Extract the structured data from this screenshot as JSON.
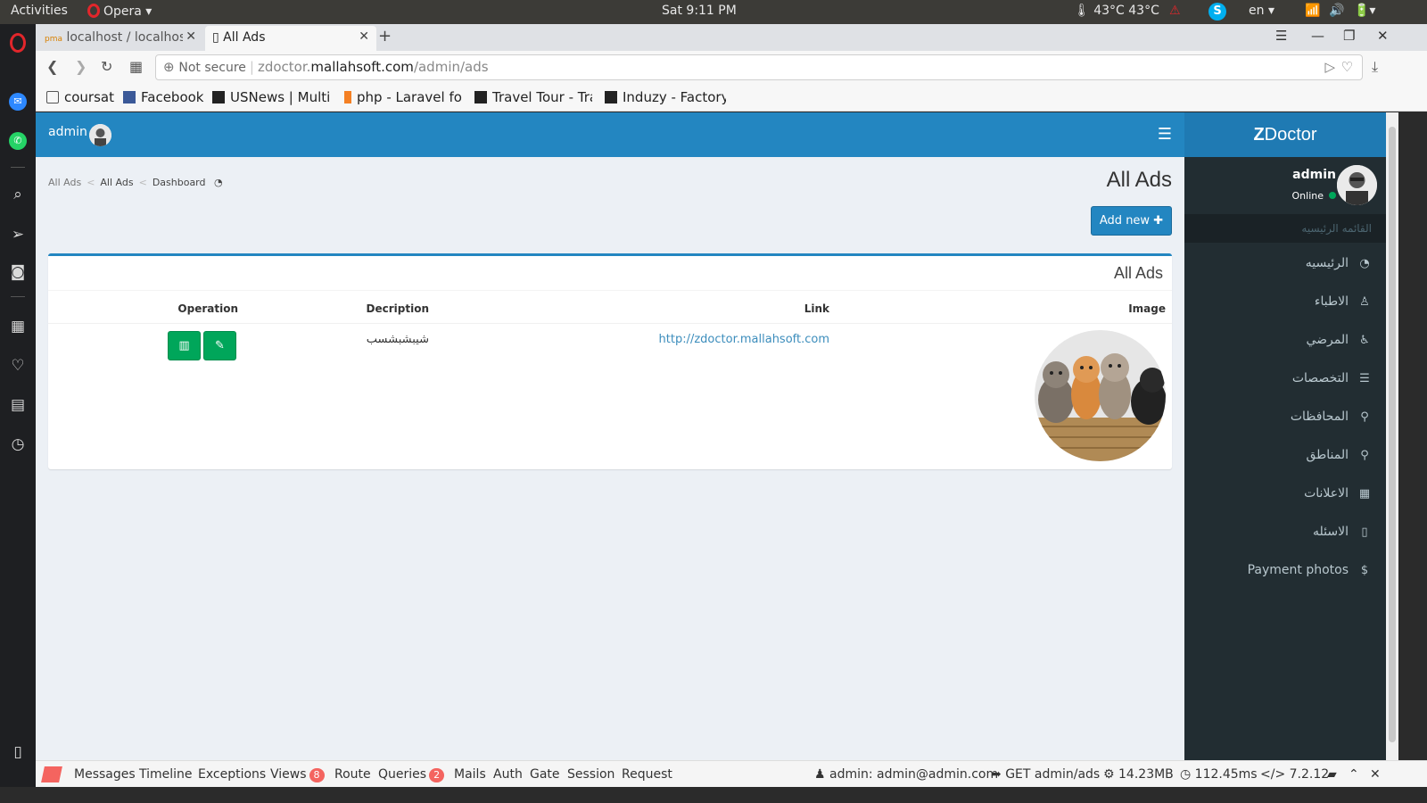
{
  "os": {
    "activities": "Activities",
    "app_name": "Opera",
    "clock": "Sat  9:11 PM",
    "temperature": "43°C 43°C",
    "lang": "en"
  },
  "browser": {
    "tabs": [
      {
        "title": "localhost / localhost",
        "active": false
      },
      {
        "title": "All Ads",
        "active": true
      }
    ],
    "url": {
      "security": "Not secure",
      "subdomain": "zdoctor.",
      "domain": "mallahsoft.com",
      "path": "/admin/ads"
    },
    "bookmarks": [
      {
        "label": "coursat",
        "icon": "folder-icon"
      },
      {
        "label": "Facebook",
        "icon": "facebook-icon"
      },
      {
        "label": "USNews | Multip",
        "icon": "theme-icon"
      },
      {
        "label": "php - Laravel for",
        "icon": "stackoverflow-icon"
      },
      {
        "label": "Travel Tour - Trav",
        "icon": "theme-icon"
      },
      {
        "label": "Induzy - Factory &",
        "icon": "theme-icon"
      }
    ]
  },
  "header": {
    "user": "admin"
  },
  "brand": {
    "bold": "Z",
    "rest": "Doctor"
  },
  "sidebar": {
    "user_name": "admin",
    "status": "Online",
    "menu_header": "القائمه الرئيسيه",
    "items": [
      {
        "label": "الرئيسيه",
        "icon": "dashboard-icon"
      },
      {
        "label": "الاطباء",
        "icon": "user-md-icon"
      },
      {
        "label": "المرضي",
        "icon": "wheelchair-icon"
      },
      {
        "label": "التخصصات",
        "icon": "list-icon"
      },
      {
        "label": "المحافظات",
        "icon": "map-marker-icon"
      },
      {
        "label": "المناطق",
        "icon": "map-marker-icon"
      },
      {
        "label": "الاعلانات",
        "icon": "film-icon"
      },
      {
        "label": "الاسئله",
        "icon": "question-icon"
      },
      {
        "label": "Payment photos",
        "icon": "dollar-icon"
      }
    ]
  },
  "page": {
    "breadcrumb": [
      "All Ads",
      "All Ads",
      "Dashboard"
    ],
    "title": "All Ads",
    "add_button": "Add new",
    "box_title": "All Ads",
    "table": {
      "headers": {
        "operation": "Operation",
        "description": "Decription",
        "link": "Link",
        "image": "Image"
      },
      "rows": [
        {
          "description": "شيبشبشسب",
          "link": "http://zdoctor.mallahsoft.com",
          "image": "kittens-image"
        }
      ]
    }
  },
  "debugbar": {
    "tabs": [
      {
        "label": "Messages"
      },
      {
        "label": "Timeline"
      },
      {
        "label": "Exceptions"
      },
      {
        "label": "Views",
        "count": "8"
      },
      {
        "label": "Route"
      },
      {
        "label": "Queries",
        "count": "2"
      },
      {
        "label": "Mails"
      },
      {
        "label": "Auth"
      },
      {
        "label": "Gate"
      },
      {
        "label": "Session"
      },
      {
        "label": "Request"
      }
    ],
    "auth": "admin: admin@admin.com",
    "route": "GET admin/ads",
    "memory": "14.23MB",
    "time": "112.45ms",
    "php": "7.2.12"
  },
  "colors": {
    "primary": "#2386c1",
    "sidebar": "#222d32",
    "success": "#00a65a",
    "link": "#3c8dbc"
  }
}
